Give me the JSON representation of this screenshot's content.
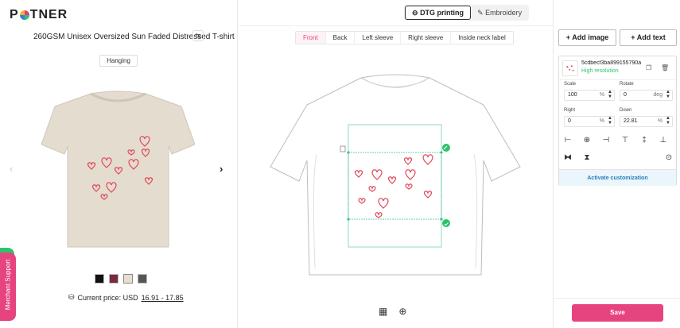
{
  "brand": {
    "logo_left": "P",
    "logo_right": "TNER"
  },
  "product": {
    "title": "260GSM Unisex Oversized Sun Faded Distressed T-shirt",
    "swap_icon": "swap-icon"
  },
  "preview": {
    "hanging_label": "Hanging",
    "shirt_color": "#e4dccf"
  },
  "swatches": [
    {
      "name": "black",
      "color": "#111111"
    },
    {
      "name": "maroon",
      "color": "#7a2a3d"
    },
    {
      "name": "sand",
      "color": "#e8ded0"
    },
    {
      "name": "charcoal",
      "color": "#555555"
    }
  ],
  "price": {
    "label": "Current price: USD",
    "value": "16.91 - 17.85"
  },
  "merchant_support": "Merchant Support",
  "methods": {
    "dtg": "DTG printing",
    "embroidery": "Embroidery"
  },
  "sides": [
    "Front",
    "Back",
    "Left sleeve",
    "Right sleeve",
    "Inside neck label"
  ],
  "actions": {
    "add_image": "+ Add image",
    "add_text": "+ Add text"
  },
  "layer": {
    "file_name": "5cdbecf3ba899155790a",
    "resolution": "High resolution"
  },
  "fields": {
    "scale": {
      "label": "Scale",
      "value": "100",
      "unit": "%"
    },
    "rotate": {
      "label": "Rotate",
      "value": "0",
      "unit": "deg"
    },
    "right": {
      "label": "Right",
      "value": "0",
      "unit": "%"
    },
    "down": {
      "label": "Down",
      "value": "22.81",
      "unit": "%"
    }
  },
  "activate_label": "Activate customization",
  "save_label": "Save",
  "colors": {
    "accent": "#e6447f",
    "green": "#2cc36b",
    "guide": "#3fbf9a"
  }
}
